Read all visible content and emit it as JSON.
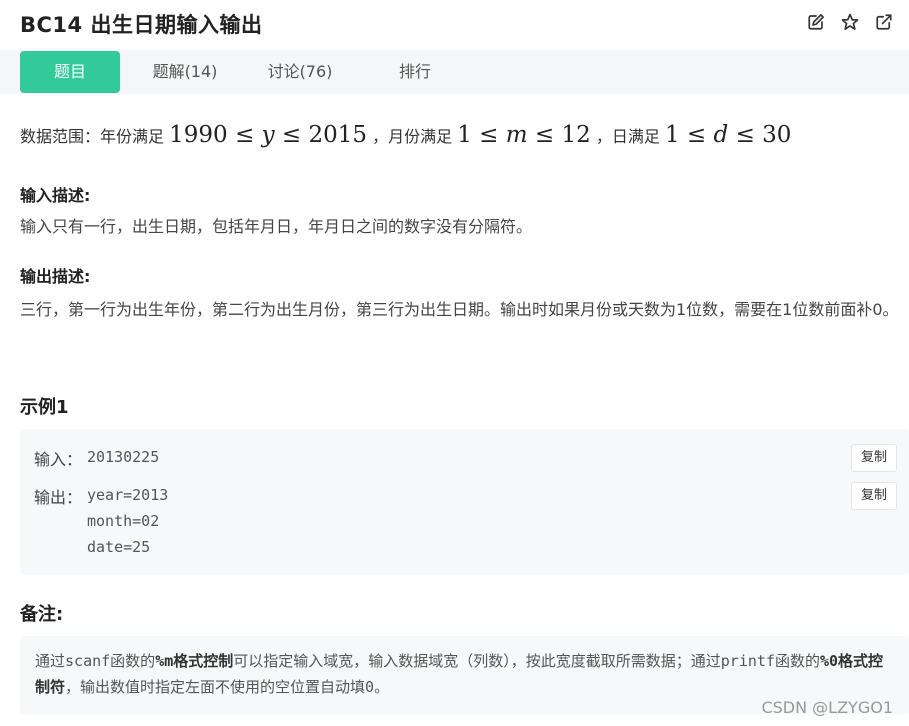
{
  "header": {
    "title": "BC14  出生日期输入输出",
    "icons": [
      "edit-icon",
      "star-icon",
      "external-link-icon"
    ]
  },
  "tabs": [
    {
      "label": "题目",
      "active": true
    },
    {
      "label": "题解(14)",
      "active": false
    },
    {
      "label": "讨论(76)",
      "active": false
    },
    {
      "label": "排行",
      "active": false
    }
  ],
  "range": {
    "prefix": "数据范围：年份满足",
    "year_min": "1990",
    "year_var": "y",
    "year_max": "2015",
    "sep1": "，月份满足",
    "month_min": "1",
    "month_var": "m",
    "month_max": "12",
    "sep2": "，日满足",
    "day_min": "1",
    "day_var": "d",
    "day_max": "30",
    "leq": "≤"
  },
  "input_desc": {
    "heading": "输入描述:",
    "text": "输入只有一行，出生日期，包括年月日，年月日之间的数字没有分隔符。"
  },
  "output_desc": {
    "heading": "输出描述:",
    "text": "三行，第一行为出生年份，第二行为出生月份，第三行为出生日期。输出时如果月份或天数为1位数，需要在1位数前面补0。"
  },
  "example": {
    "title": "示例1",
    "input_label": "输入：",
    "input_value": "20130225",
    "output_label": "输出：",
    "output_lines": [
      "year=2013",
      "month=02",
      "date=25"
    ],
    "copy_label": "复制"
  },
  "note": {
    "title": "备注:",
    "t1": "通过",
    "c1": "scanf",
    "t2": "函数的",
    "b1": "%m格式控制",
    "t3": "可以指定输入域宽，输入数据域宽（列数），按此宽度截取所需数据；通过",
    "c2": "printf",
    "t4": "函数的",
    "b2": "%0格式控制符",
    "t5": "，输出数值时指定左面不使用的空位置自动填",
    "c3": "0",
    "t6": "。"
  },
  "watermark": "CSDN @LZYGO1",
  "colors": {
    "accent": "#32ca99",
    "tabbar_bg": "#f5f6f7",
    "box_bg": "#f7f8f9"
  }
}
